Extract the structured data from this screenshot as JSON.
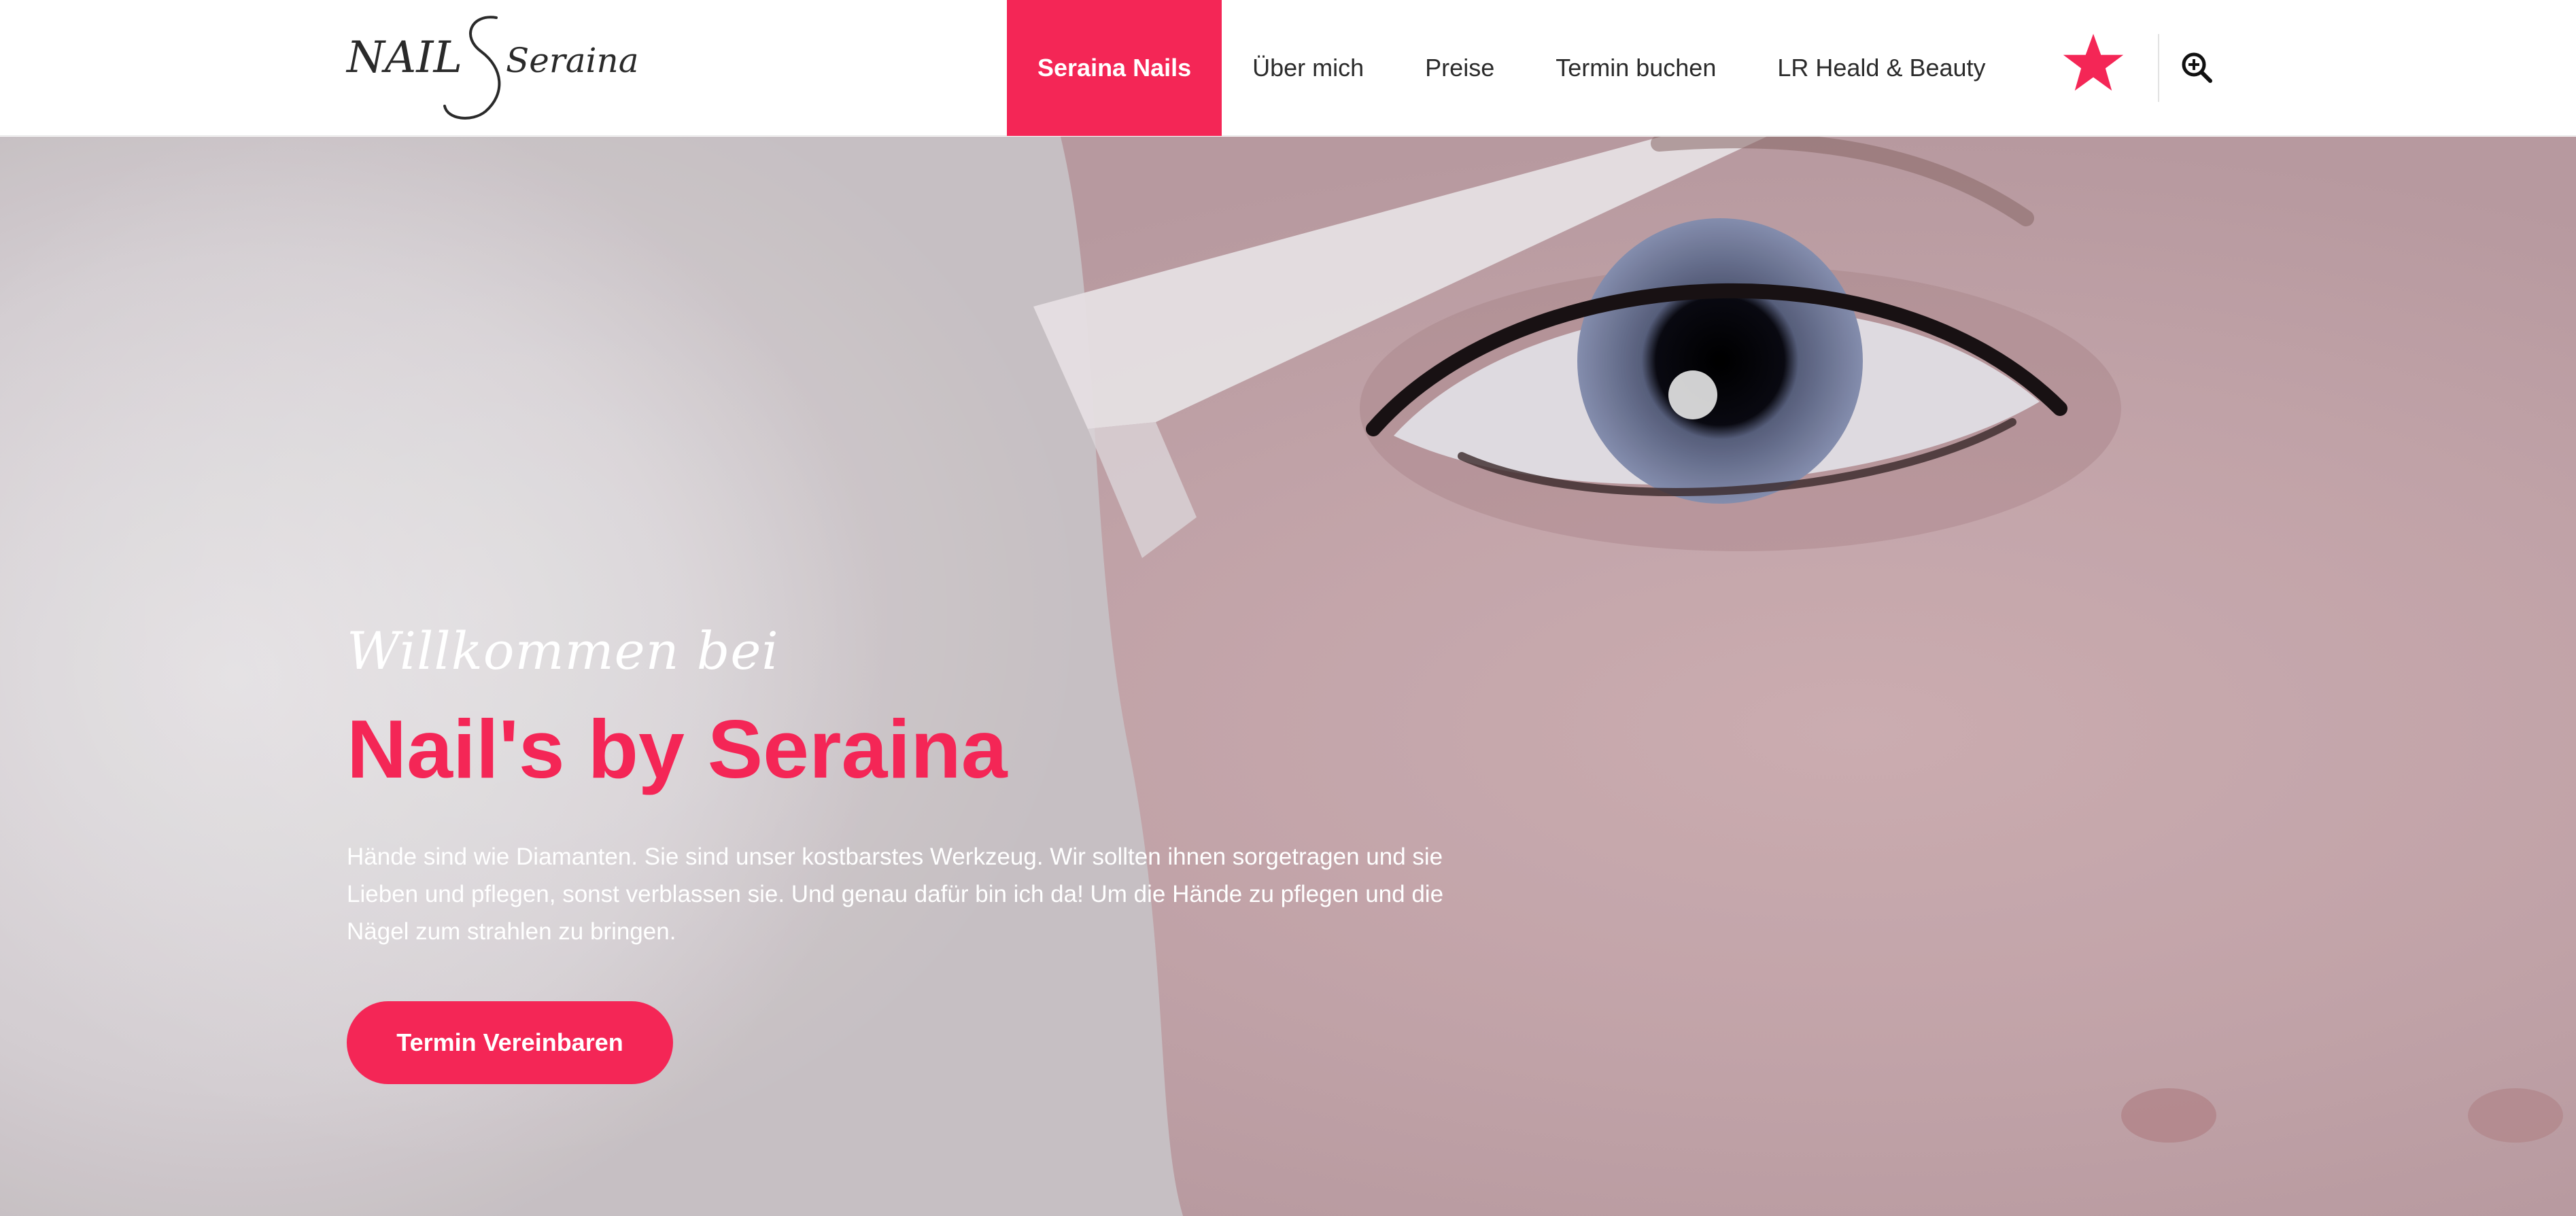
{
  "brand": {
    "logo_text_left": "NAIL",
    "logo_text_right": "Seraina",
    "accent_color": "#f42656"
  },
  "nav": {
    "items": [
      {
        "label": "Seraina Nails",
        "active": true
      },
      {
        "label": "Über mich"
      },
      {
        "label": "Preise"
      },
      {
        "label": "Termin buchen"
      },
      {
        "label": "LR Heald & Beauty"
      }
    ],
    "favorite_icon": "star-icon",
    "search_icon": "zoom-in-icon"
  },
  "hero": {
    "kicker": "Willkommen bei",
    "title": "Nail's by Seraina",
    "text": "Hände sind wie Diamanten. Sie sind unser kostbarstes Werkzeug. Wir sollten ihnen sorgetragen und sie Lieben und pflegen, sonst verblassen sie. Und genau dafür bin ich da! Um die Hände zu pflegen und die Nägel zum strahlen zu bringen.",
    "cta_label": "Termin Vereinbaren"
  }
}
